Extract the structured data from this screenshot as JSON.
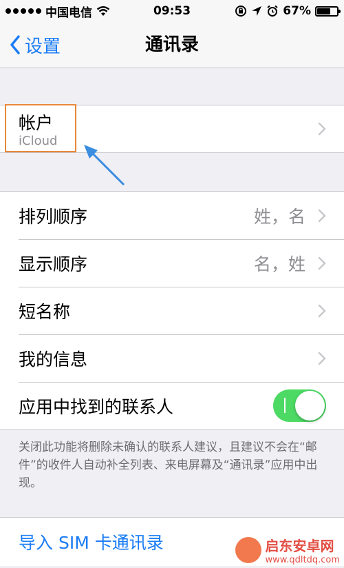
{
  "status_bar": {
    "carrier": "中国电信",
    "time": "09:53",
    "battery": "67%",
    "battery_level": 0.67
  },
  "nav": {
    "back_label": "设置",
    "title": "通讯录"
  },
  "account": {
    "title": "帐户",
    "subtitle": "iCloud"
  },
  "settings": {
    "sort_order": {
      "label": "排列顺序",
      "value": "姓，名"
    },
    "display_order": {
      "label": "显示顺序",
      "value": "名，姓"
    },
    "short_name": {
      "label": "短名称"
    },
    "my_info": {
      "label": "我的信息"
    },
    "found_contacts": {
      "label": "应用中找到的联系人",
      "enabled": true
    }
  },
  "footnote": "关闭此功能将删除未确认的联系人建议，且建议不会在“邮件”的收件人自动补全列表、来电屏幕及“通讯录”应用中出现。",
  "import_sim": {
    "label": "导入 SIM 卡通讯录"
  },
  "watermark": {
    "title": "启东安卓网",
    "url": "www.qdltdq.com"
  },
  "colors": {
    "accent": "#1a7cf5",
    "toggle_on": "#4cd964",
    "highlight": "#e8893a",
    "arrow": "#3a8de0"
  }
}
